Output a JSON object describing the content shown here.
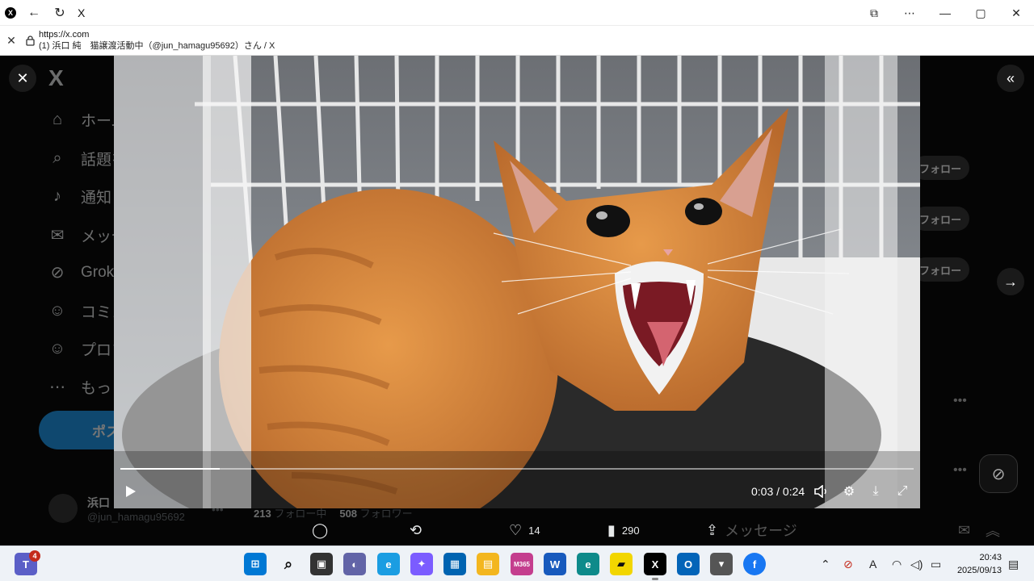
{
  "browser": {
    "tab_title": "X",
    "url_host": "https://x.com",
    "page_title": "(1) 浜口 純　猫譲渡活動中（@jun_hamagu95692）さん / X"
  },
  "sidebar": {
    "logo": "X",
    "items": [
      {
        "label": "ホーム",
        "icon": "home-icon",
        "glyph": "⌂"
      },
      {
        "label": "話題を検索",
        "icon": "search-icon",
        "glyph": "⌕"
      },
      {
        "label": "通知",
        "icon": "bell-icon",
        "glyph": "♪"
      },
      {
        "label": "メッセージ",
        "icon": "mail-icon",
        "glyph": "✉"
      },
      {
        "label": "Grok",
        "icon": "grok-icon",
        "glyph": "⊘"
      },
      {
        "label": "コミュニティ",
        "icon": "community-icon",
        "glyph": "☺"
      },
      {
        "label": "プロフィール",
        "icon": "profile-icon",
        "glyph": "☺"
      },
      {
        "label": "もっと見る",
        "icon": "more-icon",
        "glyph": "⋯"
      }
    ],
    "post_button": "ポスト",
    "profile": {
      "name": "浜口",
      "handle": "@jun_hamagu95692"
    }
  },
  "profile_stats": {
    "following_count": "213",
    "following_label": "フォロー中",
    "followers_count": "508",
    "followers_label": "フォロワー"
  },
  "right_column": {
    "follow_label": "フォロー"
  },
  "video": {
    "current_time": "0:03",
    "duration": "0:24",
    "time_display": "0:03 / 0:24",
    "progress": 0.125
  },
  "actions": {
    "reply_count": "",
    "repost_count": "",
    "like_count": "14",
    "view_count": "290",
    "messages_label": "メッセージ"
  },
  "taskbar": {
    "teams_badge": "4",
    "clock_time": "20:43",
    "clock_date": "2025/09/13"
  },
  "colors": {
    "accent": "#1d9bf0",
    "background": "#000000",
    "taskbar": "#eef2f7"
  }
}
